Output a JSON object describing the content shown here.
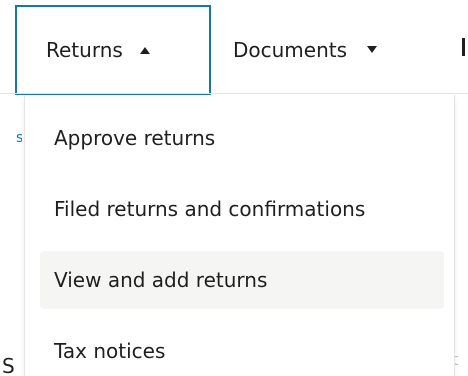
{
  "nav": {
    "returns_label": "Returns",
    "documents_label": "Documents"
  },
  "menu": {
    "items": [
      {
        "label": "Approve returns"
      },
      {
        "label": "Filed returns and confirmations"
      },
      {
        "label": "View and add returns"
      },
      {
        "label": "Tax notices"
      }
    ],
    "hovered_index": 2
  },
  "background": {
    "fragment_top": "s",
    "fragment_bottom": "S",
    "fragment_right": "t"
  },
  "icons": {
    "returns_caret": "caret-up-icon",
    "documents_caret": "caret-down-icon"
  },
  "colors": {
    "focus_border": "#1478ae",
    "hover_background": "#f5f5f4",
    "text": "#1f1f1f"
  }
}
